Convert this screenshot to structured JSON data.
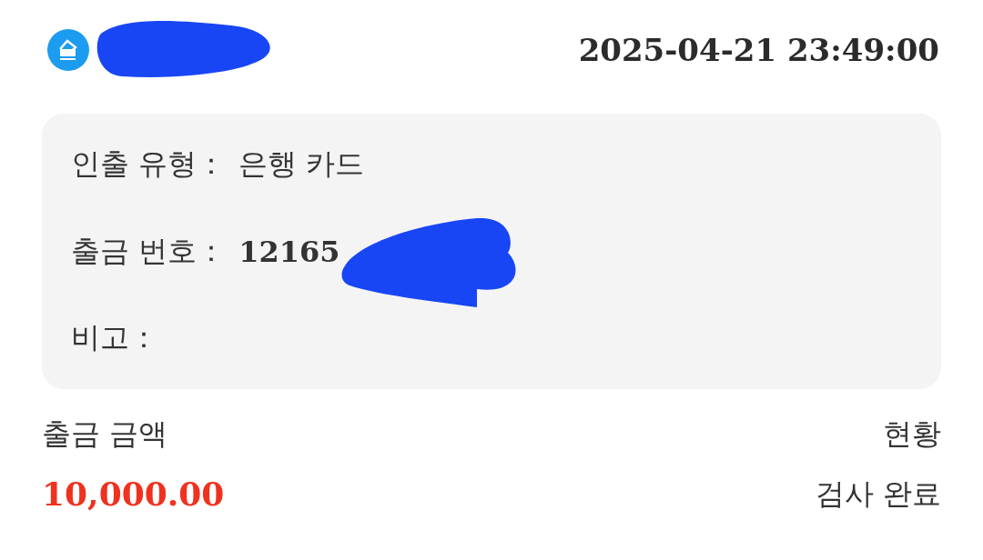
{
  "header": {
    "datetime": "2025-04-21 23:49:00"
  },
  "details": [
    {
      "label": "인출 유형：",
      "value": "은행 카드",
      "kind": "plain"
    },
    {
      "label": "출금 번호：",
      "value": "12165",
      "kind": "bold"
    },
    {
      "label": "비고："
    }
  ],
  "amount": {
    "label": "출금 금액",
    "value": "10,000.00"
  },
  "status": {
    "label": "현황",
    "value": "검사 완료"
  }
}
